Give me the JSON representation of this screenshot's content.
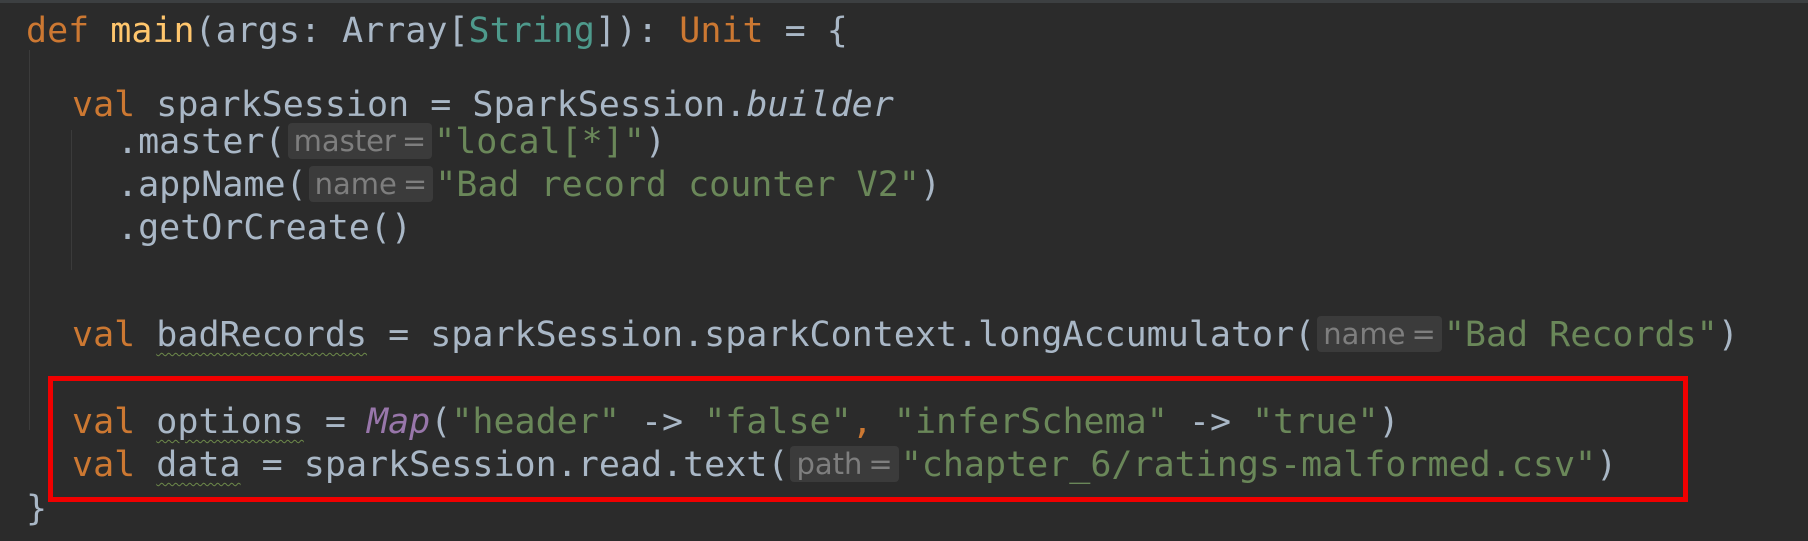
{
  "code": {
    "line1": {
      "kw_def": "def",
      "fn_name": "main",
      "open": "(args: ",
      "type_array": "Array[",
      "type_string": "String",
      "after_string": "]): ",
      "type_unit": "Unit",
      "tail": " = {"
    },
    "line2": {
      "kw_val": "val",
      "rest": " sparkSession = SparkSession.",
      "builder": "builder"
    },
    "line3": {
      "prefix": ".master(",
      "hint_name": "master",
      "hint_eq": "=",
      "str": "\"local[*]\"",
      "close": ")"
    },
    "line4": {
      "prefix": ".appName(",
      "hint_name": "name",
      "hint_eq": "=",
      "str": "\"Bad record counter V2\"",
      "close": ")"
    },
    "line5": {
      "text": ".getOrCreate()"
    },
    "line6": {
      "kw_val": "val",
      "var": "badRecords",
      "rest": " = sparkSession.sparkContext.longAccumulator(",
      "hint_name": "name",
      "hint_eq": "=",
      "str": "\"Bad Records\"",
      "close": ")"
    },
    "line7": {
      "kw_val": "val",
      "var": "options",
      "eq": " = ",
      "map": "Map",
      "open": "(",
      "s1": "\"header\"",
      "arrow1": " -> ",
      "s2": "\"false\"",
      "comma": ", ",
      "s3": "\"inferSchema\"",
      "arrow2": " -> ",
      "s4": "\"true\"",
      "close": ")"
    },
    "line8": {
      "kw_val": "val",
      "var": "data",
      "rest": " = sparkSession.read.text(",
      "hint_name": "path",
      "hint_eq": "=",
      "str": "\"chapter_6/ratings-malformed.csv\"",
      "close": ")"
    },
    "line9": {
      "text": "}"
    }
  },
  "colors": {
    "background": "#2b2b2b",
    "keyword": "#cc7832",
    "function": "#ffc66d",
    "type": "#4e9a8c",
    "string": "#6a8759",
    "plain": "#a9b7c6",
    "highlight_border": "#f00000"
  }
}
